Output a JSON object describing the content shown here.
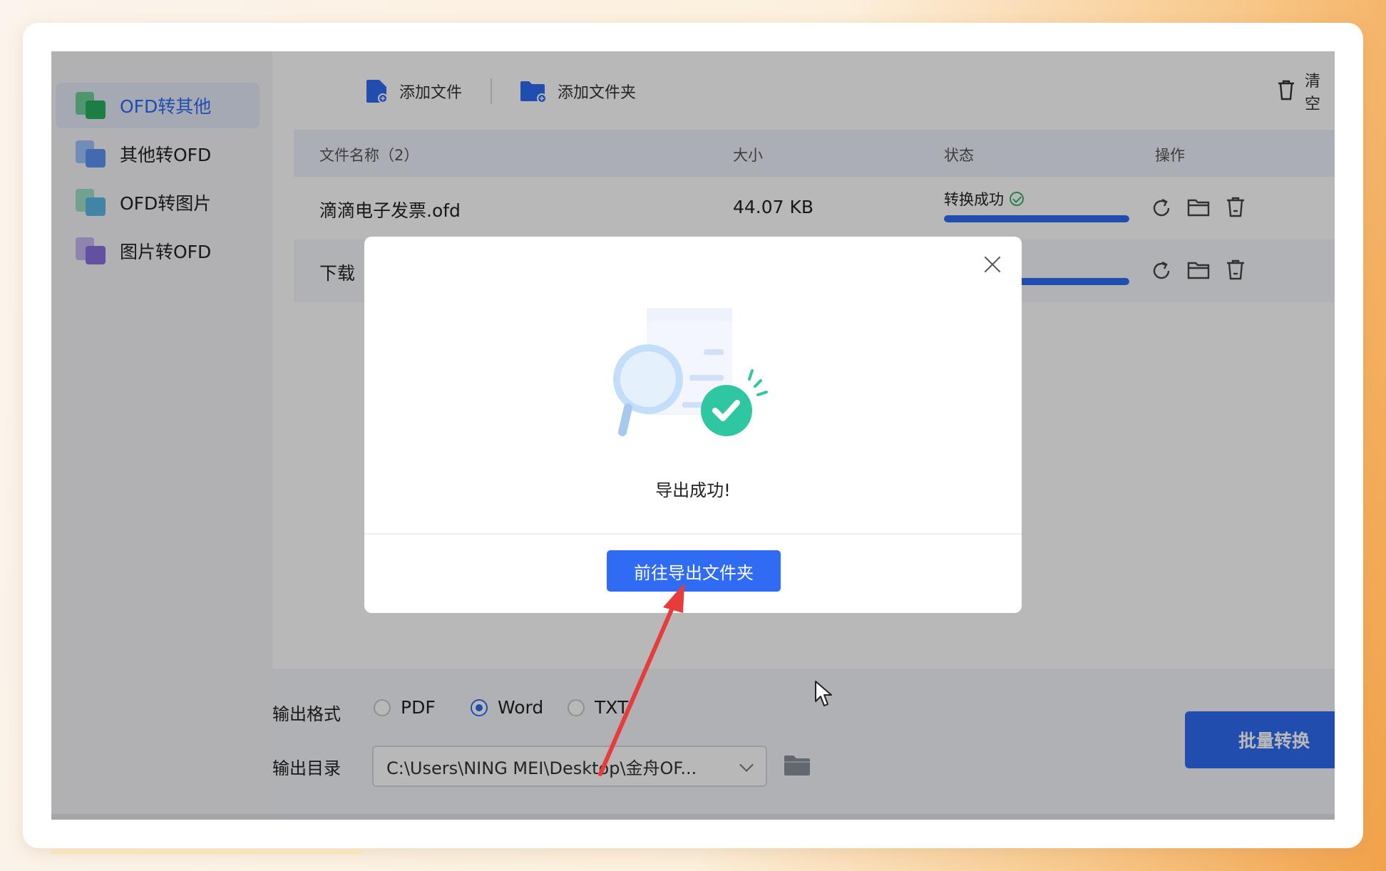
{
  "sidebar": {
    "items": [
      {
        "label": "OFD转其他",
        "active": true
      },
      {
        "label": "其他转OFD",
        "active": false
      },
      {
        "label": "OFD转图片",
        "active": false
      },
      {
        "label": "图片转OFD",
        "active": false
      }
    ]
  },
  "toolbar": {
    "add_file": "添加文件",
    "add_folder": "添加文件夹",
    "clear": "清空"
  },
  "table": {
    "headers": {
      "name": "文件名称（2）",
      "size": "大小",
      "status": "状态",
      "ops": "操作"
    },
    "rows": [
      {
        "name": "滴滴电子发票.ofd",
        "size": "44.07 KB",
        "status": "转换成功",
        "progress": 1.0
      },
      {
        "name": "下载",
        "size": "",
        "status": "",
        "progress": 1.0
      }
    ]
  },
  "output": {
    "format_label": "输出格式",
    "formats": [
      {
        "label": "PDF",
        "checked": false
      },
      {
        "label": "Word",
        "checked": true
      },
      {
        "label": "TXT",
        "checked": false
      }
    ],
    "dir_label": "输出目录",
    "dir_value": "C:\\Users\\NING MEI\\Desktop\\金舟OF..."
  },
  "convert_button": "批量转换",
  "dialog": {
    "message": "导出成功!",
    "button": "前往导出文件夹"
  },
  "colors": {
    "accent": "#2f6bf3",
    "success": "#39b36b"
  }
}
